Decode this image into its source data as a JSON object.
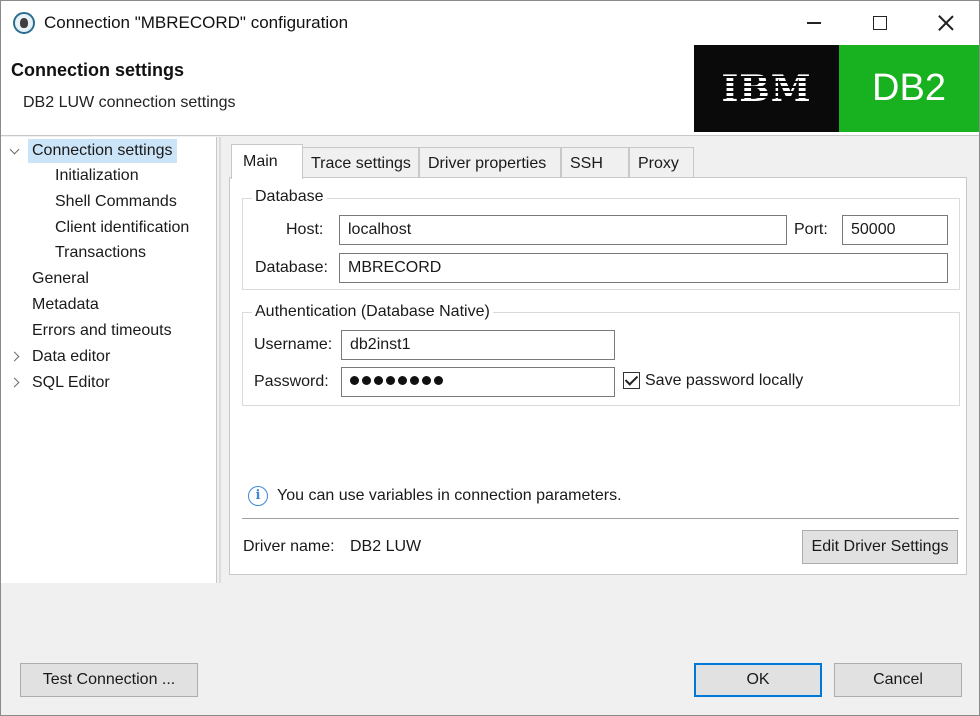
{
  "window": {
    "title": "Connection \"MBRECORD\" configuration"
  },
  "header": {
    "title": "Connection settings",
    "subtitle": "DB2 LUW connection settings",
    "logo_left": "IBM",
    "logo_right": "DB2",
    "colors": {
      "ibm_bg": "#0a0a0a",
      "db2_bg": "#18b120"
    }
  },
  "nav": {
    "items": [
      {
        "label": "Connection settings",
        "expander": "expanded",
        "selected": true
      },
      {
        "label": "Initialization"
      },
      {
        "label": "Shell Commands"
      },
      {
        "label": "Client identification"
      },
      {
        "label": "Transactions"
      },
      {
        "label": "General"
      },
      {
        "label": "Metadata"
      },
      {
        "label": "Errors and timeouts"
      },
      {
        "label": "Data editor",
        "expander": "collapsed"
      },
      {
        "label": "SQL Editor",
        "expander": "collapsed"
      }
    ]
  },
  "tabs": [
    {
      "label": "Main",
      "active": true
    },
    {
      "label": "Trace settings"
    },
    {
      "label": "Driver properties"
    },
    {
      "label": "SSH"
    },
    {
      "label": "Proxy"
    }
  ],
  "database_group": {
    "title": "Database",
    "host_label": "Host:",
    "host_value": "localhost",
    "port_label": "Port:",
    "port_value": "50000",
    "database_label": "Database:",
    "database_value": "MBRECORD"
  },
  "auth_group": {
    "title": "Authentication (Database Native)",
    "username_label": "Username:",
    "username_value": "db2inst1",
    "password_label": "Password:",
    "password_mask_count": 8,
    "save_password_label": "Save password locally",
    "save_password_checked": true
  },
  "info": {
    "text": "You can use variables in connection parameters.",
    "icon": "info-icon"
  },
  "driver": {
    "name_label": "Driver name:",
    "name_value": "DB2 LUW",
    "edit_button": "Edit Driver Settings"
  },
  "footer": {
    "test_button": "Test Connection ...",
    "ok_button": "OK",
    "cancel_button": "Cancel"
  }
}
